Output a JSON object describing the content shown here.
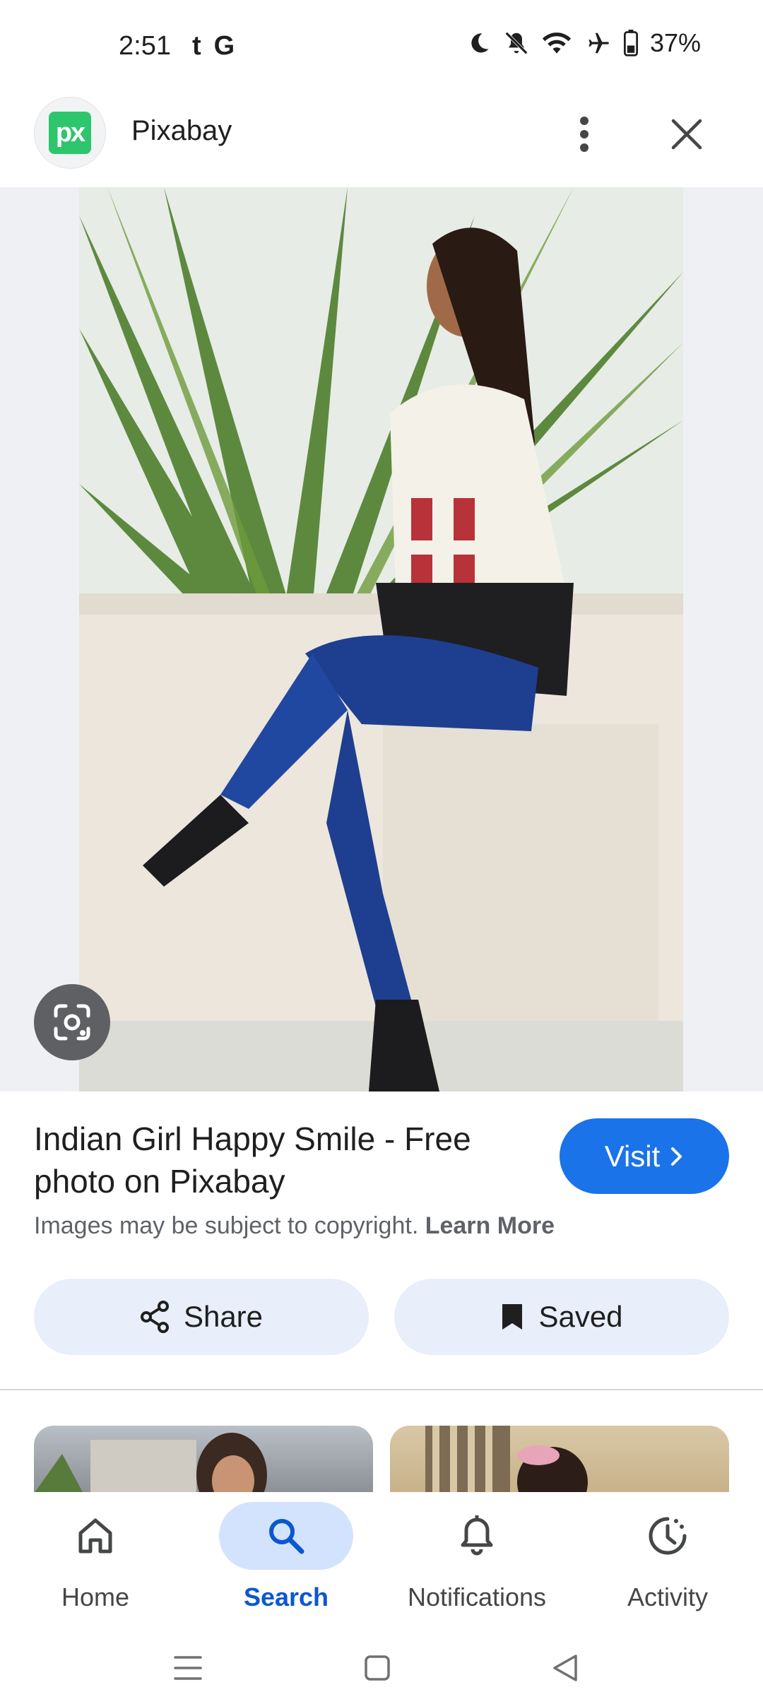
{
  "status_bar": {
    "time": "2:51",
    "app_icons": [
      "t",
      "G"
    ],
    "battery": "37%"
  },
  "header": {
    "site_name": "Pixabay",
    "logo_text": "px"
  },
  "result": {
    "title": "Indian Girl Happy Smile - Free photo on Pixabay",
    "copyright_text": "Images may be subject to copyright.",
    "learn_more": "Learn More",
    "visit_label": "Visit"
  },
  "actions": {
    "share_label": "Share",
    "saved_label": "Saved"
  },
  "bottom_nav": {
    "items": [
      {
        "label": "Home",
        "icon": "home-icon"
      },
      {
        "label": "Search",
        "icon": "search-icon",
        "active": true
      },
      {
        "label": "Notifications",
        "icon": "bell-icon"
      },
      {
        "label": "Activity",
        "icon": "activity-icon"
      }
    ]
  },
  "colors": {
    "accent": "#1a73e8",
    "active_nav": "#0b57d0",
    "pill_bg": "#e8eefa",
    "logo_green": "#2ec66d"
  }
}
